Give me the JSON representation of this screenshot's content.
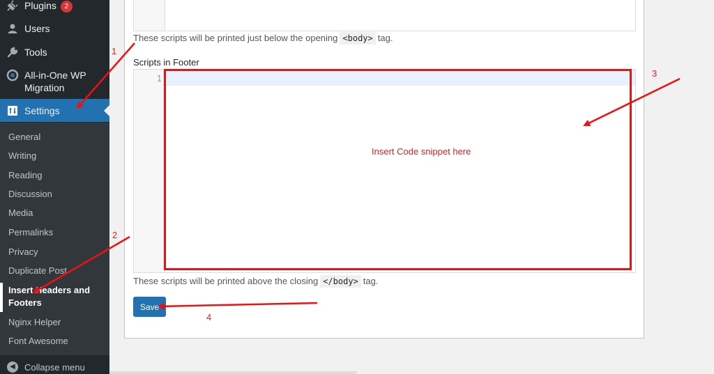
{
  "sidebar": {
    "items": [
      {
        "label": "Plugins",
        "badge": "2",
        "icon": "plugin-icon"
      },
      {
        "label": "Users",
        "icon": "users-icon"
      },
      {
        "label": "Tools",
        "icon": "wrench-icon"
      },
      {
        "label": "All-in-One WP Migration",
        "icon": "migration-icon"
      },
      {
        "label": "Settings",
        "icon": "settings-icon"
      }
    ],
    "submenu": [
      "General",
      "Writing",
      "Reading",
      "Discussion",
      "Media",
      "Permalinks",
      "Privacy",
      "Duplicate Post",
      "Insert Headers and Footers",
      "Nginx Helper",
      "Font Awesome"
    ],
    "collapse_label": "Collapse menu"
  },
  "main": {
    "header_desc_pre": "These scripts will be printed just below the opening",
    "header_desc_code": "<body>",
    "header_desc_post": "tag.",
    "footer_label": "Scripts in Footer",
    "footer_line_number": "1",
    "footer_desc_pre": "These scripts will be printed above the closing",
    "footer_desc_code": "</body>",
    "footer_desc_post": "tag.",
    "save_label": "Save"
  },
  "annotations": {
    "step1": "1",
    "step2": "2",
    "step3": "3",
    "step4": "4",
    "snippet_note": "Insert Code snippet here"
  },
  "colors": {
    "sidebar_bg": "#23282d",
    "submenu_bg": "#32373c",
    "accent": "#2271b1",
    "badge": "#d63638",
    "annotation": "#ee1111"
  }
}
